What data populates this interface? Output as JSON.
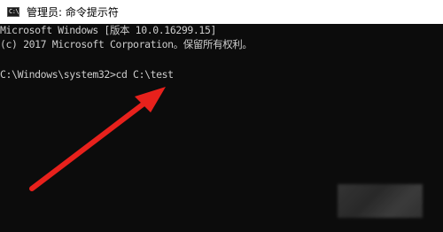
{
  "window": {
    "title": "管理员: 命令提示符",
    "icon": "terminal-icon",
    "icon_text": "C:\\"
  },
  "console": {
    "lines": [
      "Microsoft Windows [版本 10.0.16299.15]",
      "(c) 2017 Microsoft Corporation。保留所有权利。",
      "C:\\Windows\\system32>cd C:\\test"
    ]
  },
  "annotation": {
    "arrow_color": "#e8211c",
    "arrow_icon": "red-arrow-icon"
  },
  "colors": {
    "console_bg": "#0c0c0c",
    "console_text": "#cccccc",
    "titlebar_bg": "#ffffff"
  }
}
